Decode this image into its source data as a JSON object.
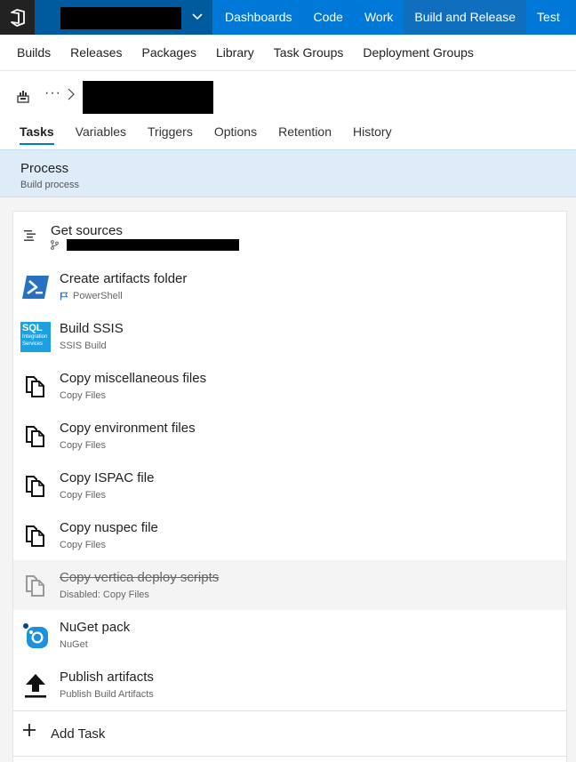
{
  "topbar": {
    "nav": [
      "Dashboards",
      "Code",
      "Work",
      "Build and Release",
      "Test"
    ],
    "active": "Build and Release"
  },
  "subnav": [
    "Builds",
    "Releases",
    "Packages",
    "Library",
    "Task Groups",
    "Deployment Groups"
  ],
  "breadcrumb": {
    "ellipsis": "···"
  },
  "tabs": [
    "Tasks",
    "Variables",
    "Triggers",
    "Options",
    "Retention",
    "History"
  ],
  "process": {
    "title": "Process",
    "subtitle": "Build process"
  },
  "get_sources": {
    "name": "Get sources"
  },
  "tasks": [
    {
      "name": "Create artifacts folder",
      "type": "PowerShell",
      "icon": "powershell-icon"
    },
    {
      "name": "Build SSIS",
      "type": "SSIS Build",
      "icon": "sql-integration-services-icon",
      "icon_text": [
        "SQL",
        "Integration",
        "Services"
      ]
    },
    {
      "name": "Copy miscellaneous files",
      "type": "Copy Files",
      "icon": "copy-files-icon"
    },
    {
      "name": "Copy environment files",
      "type": "Copy Files",
      "icon": "copy-files-icon"
    },
    {
      "name": "Copy ISPAC file",
      "type": "Copy Files",
      "icon": "copy-files-icon"
    },
    {
      "name": "Copy nuspec file",
      "type": "Copy Files",
      "icon": "copy-files-icon"
    },
    {
      "name": "Copy vertica deploy scripts",
      "type": "Disabled: Copy Files",
      "icon": "copy-files-icon",
      "disabled": true
    },
    {
      "name": "NuGet pack",
      "type": "NuGet",
      "icon": "nuget-icon"
    },
    {
      "name": "Publish artifacts",
      "type": "Publish Build Artifacts",
      "icon": "upload-icon"
    }
  ],
  "add_task": {
    "label": "Add Task"
  },
  "colors": {
    "brand": "#0078d7",
    "active_nav": "#106ebe",
    "process_bg": "#deecf9",
    "logo_bg": "#222222"
  }
}
